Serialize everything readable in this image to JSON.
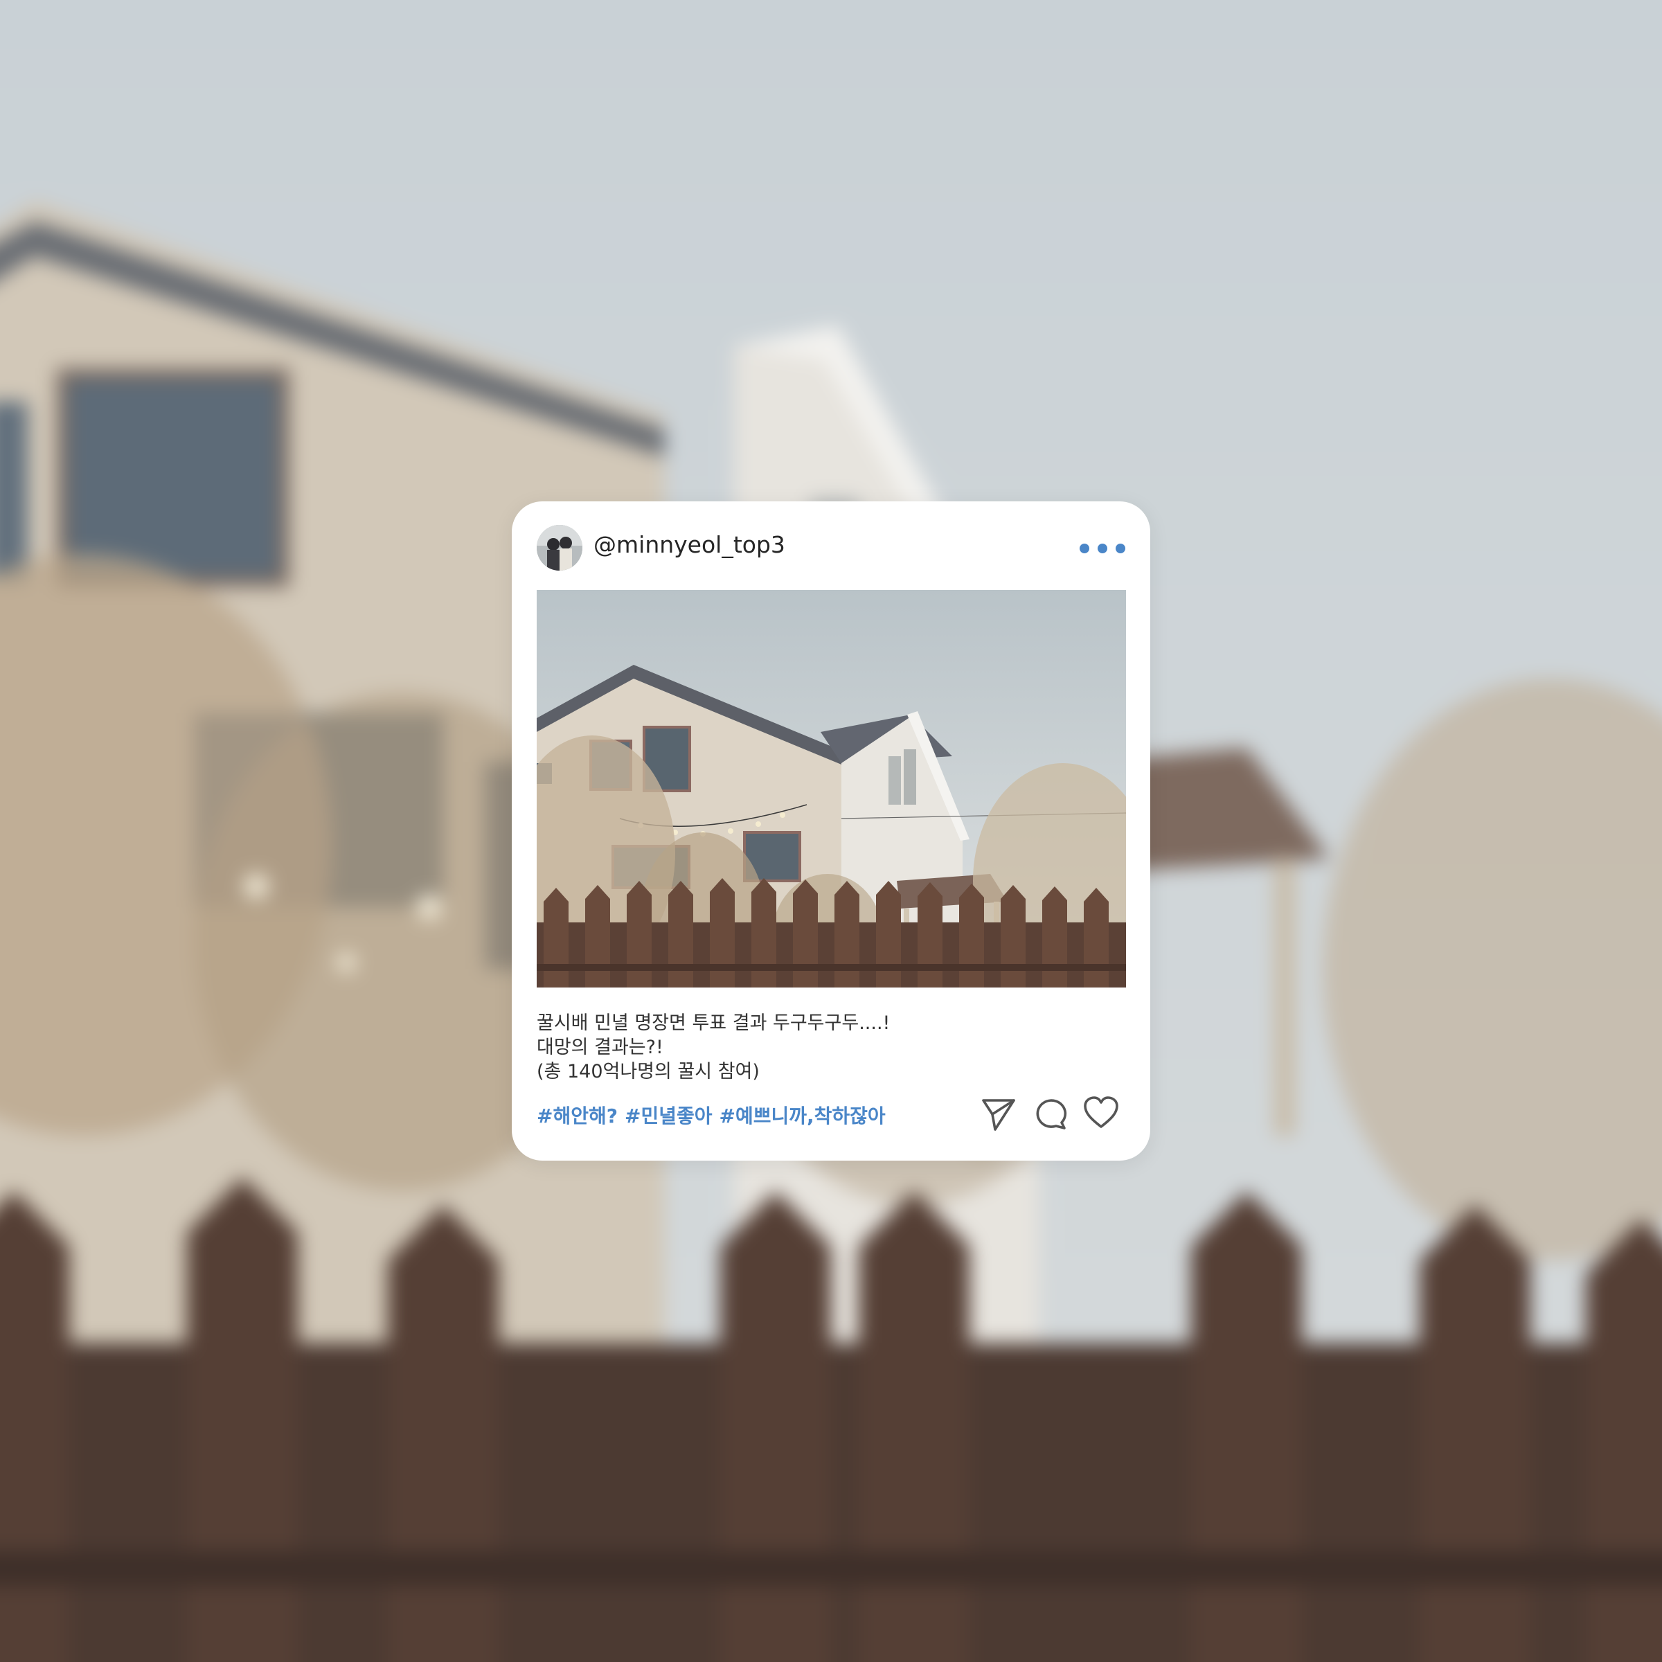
{
  "post": {
    "username": "@minnyeol_top3",
    "avatar_icon": "profile-photo",
    "more_icon": "more-horizontal-icon",
    "image_alt": "house-with-fence-photo",
    "caption_lines": [
      "꿀시배 민녈 명장면 투표 결과 두구두구두....!",
      "대망의 결과는?!",
      "(총 140억나명의 꿀시 참여)"
    ],
    "hashtags": [
      "#해안해?",
      "#민녈좋아",
      "#예쁘니까,착하잖아"
    ],
    "actions": {
      "share_icon": "send-icon",
      "comment_icon": "comment-icon",
      "like_icon": "heart-icon"
    }
  },
  "colors": {
    "accent": "#4a86c8",
    "card": "#ffffff",
    "text": "#262626"
  }
}
